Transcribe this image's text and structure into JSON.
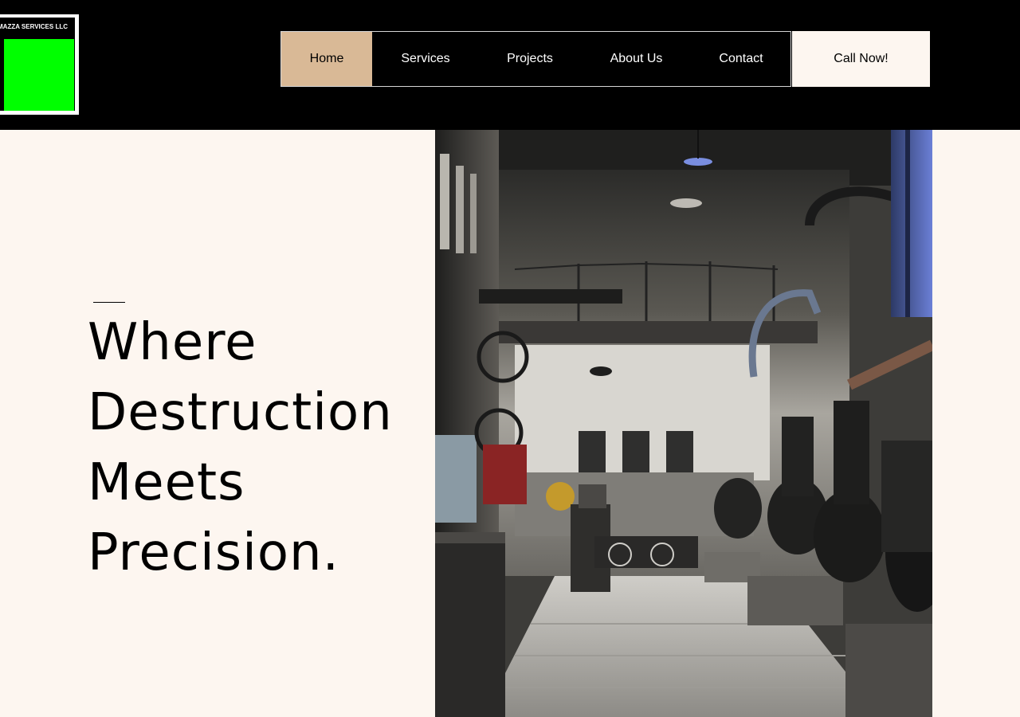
{
  "header": {
    "logo": {
      "text": "MAZZA SERVICES LLC",
      "accent_color": "#00ff00"
    },
    "nav": {
      "items": [
        {
          "label": "Home",
          "active": true
        },
        {
          "label": "Services",
          "active": false
        },
        {
          "label": "Projects",
          "active": false
        },
        {
          "label": "About Us",
          "active": false
        },
        {
          "label": "Contact",
          "active": false
        }
      ],
      "active_color": "#d9b996"
    },
    "cta": {
      "label": "Call Now!"
    }
  },
  "hero": {
    "title_lines": [
      "Where",
      "Destruction",
      "Meets",
      "Precision."
    ],
    "image": {
      "icon": "industrial-factory-photo"
    }
  },
  "colors": {
    "background": "#fdf6f0",
    "header": "#000000",
    "text": "#000000"
  }
}
